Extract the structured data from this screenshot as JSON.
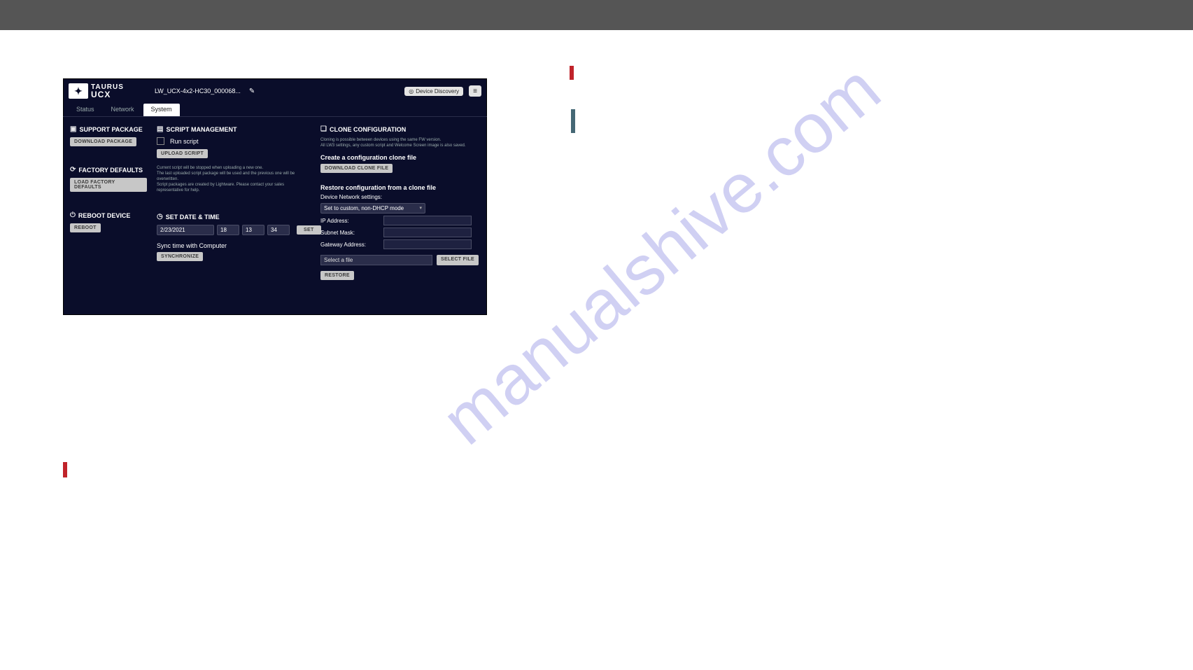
{
  "watermark": "manualshive.com",
  "header": {
    "logo_top": "TAURUS",
    "logo_bottom": "UCX",
    "device_name": "LW_UCX-4x2-HC30_000068...",
    "device_discovery": "Device Discovery"
  },
  "tabs": {
    "status": "Status",
    "network": "Network",
    "system": "System"
  },
  "col1": {
    "support_package": "SUPPORT PACKAGE",
    "download_package": "DOWNLOAD PACKAGE",
    "factory_defaults": "FACTORY DEFAULTS",
    "load_factory_defaults": "LOAD FACTORY DEFAULTS",
    "reboot_device": "REBOOT DEVICE",
    "reboot": "REBOOT"
  },
  "col2": {
    "script_mgmt": "SCRIPT MANAGEMENT",
    "run_script": "Run script",
    "upload_script": "UPLOAD SCRIPT",
    "note_line1": "Current script will be stopped when uploading a new one.",
    "note_line2": "The last uploaded script package will be used and the previous one will be overwritten.",
    "note_line3": "Script packages are created by Lightware. Please contact your sales representative for help.",
    "set_datetime": "SET DATE & TIME",
    "date": "2/23/2021",
    "hour": "18",
    "min": "13",
    "sec": "34",
    "set": "SET",
    "sync_label": "Sync time with Computer",
    "synchronize": "SYNCHRONIZE"
  },
  "col3": {
    "clone_config": "CLONE CONFIGURATION",
    "note_line1": "Cloning is possible between devices using the same FW version.",
    "note_line2": "All LW3 settings, any custom script and Welcome Screen image is also saved.",
    "create_clone": "Create a configuration clone file",
    "download_clone": "DOWNLOAD CLONE FILE",
    "restore_from": "Restore configuration from a clone file",
    "dev_net_settings": "Device Network settings:",
    "mode": "Set to custom, non-DHCP mode",
    "ip": "IP Address:",
    "subnet": "Subnet Mask:",
    "gateway": "Gateway Address:",
    "file_placeholder": "Select a file",
    "select_file": "SELECT FILE",
    "restore": "RESTORE"
  }
}
